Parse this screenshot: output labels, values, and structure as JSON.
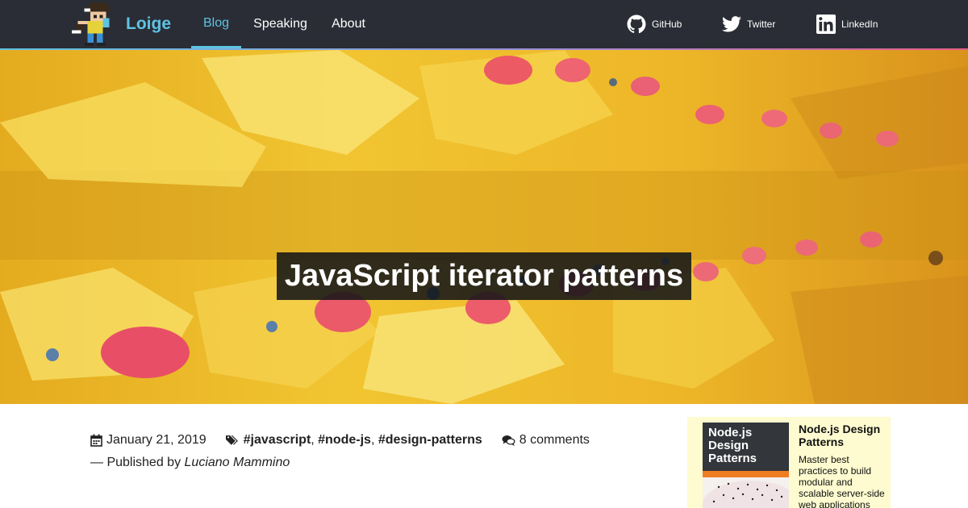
{
  "site": {
    "name": "Loige",
    "accent_color": "#5fc3e4",
    "navbar_color": "#2a2d35"
  },
  "nav": {
    "items": [
      {
        "label": "Blog",
        "active": true
      },
      {
        "label": "Speaking",
        "active": false
      },
      {
        "label": "About",
        "active": false
      }
    ]
  },
  "social": {
    "items": [
      {
        "label": "GitHub",
        "icon": "github-icon"
      },
      {
        "label": "Twitter",
        "icon": "twitter-icon"
      },
      {
        "label": "LinkedIn",
        "icon": "linkedin-icon"
      }
    ]
  },
  "post": {
    "title": "JavaScript iterator patterns",
    "date": "January 21, 2019",
    "tags": [
      "#javascript",
      "#node-js",
      "#design-patterns"
    ],
    "tag_separator": ", ",
    "comments": "8 comments",
    "published_prefix": "— Published by ",
    "author": "Luciano Mammino"
  },
  "promo": {
    "title": "Node.js Design Patterns",
    "text": "Master best practices to build modular and scalable server-side web applications",
    "cover_title": "Node.js Design Patterns"
  }
}
